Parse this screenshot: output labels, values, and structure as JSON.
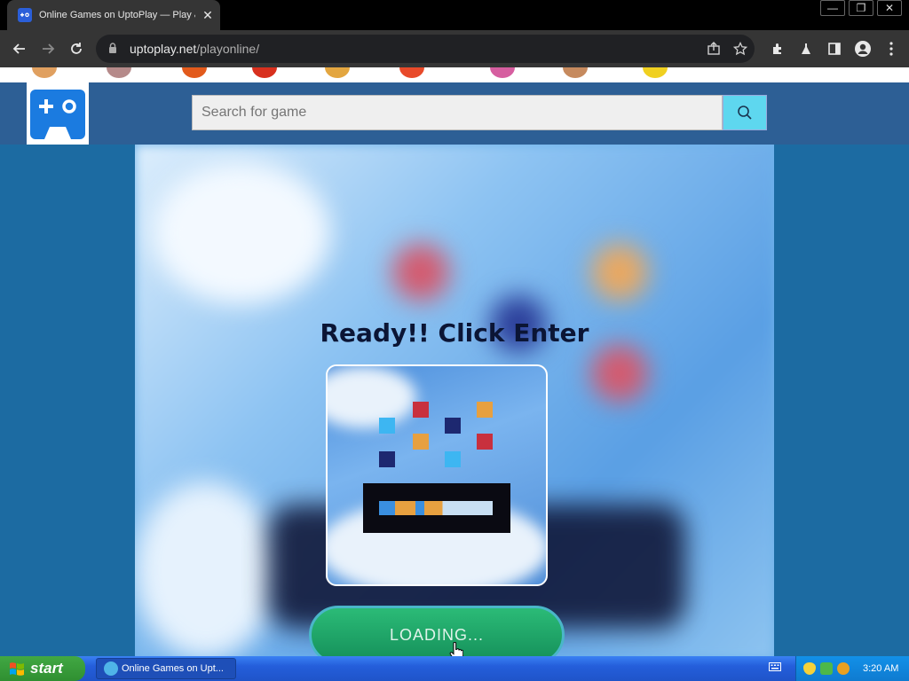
{
  "browser": {
    "tab_title": "Online Games on UptoPlay — Play & ",
    "tab_close": "✕",
    "url_domain": "uptoplay.net",
    "url_path": "/playonline/"
  },
  "window_controls": {
    "minimize": "—",
    "restore": "❐",
    "close": "✕"
  },
  "header": {
    "search_placeholder": "Search for game"
  },
  "game": {
    "ready_text": "Ready!! Click Enter",
    "loading_label": "LOADING..."
  },
  "taskbar": {
    "start_label": "start",
    "task_item_label": "Online Games on Upt...",
    "clock": "3:20 AM"
  },
  "colors": {
    "page_bg": "#1c6ba2",
    "header_bg": "#2d5f95",
    "search_button": "#5ed7ef",
    "loading_button": "#1fa566"
  },
  "icons": [
    "back-icon",
    "forward-icon",
    "reload-icon",
    "lock-icon",
    "share-icon",
    "star-icon",
    "extensions-icon",
    "labs-icon",
    "side-panel-icon",
    "profile-icon",
    "menu-icon",
    "search-icon",
    "gamepad-logo-icon",
    "windows-flag-icon",
    "ie-icon"
  ]
}
